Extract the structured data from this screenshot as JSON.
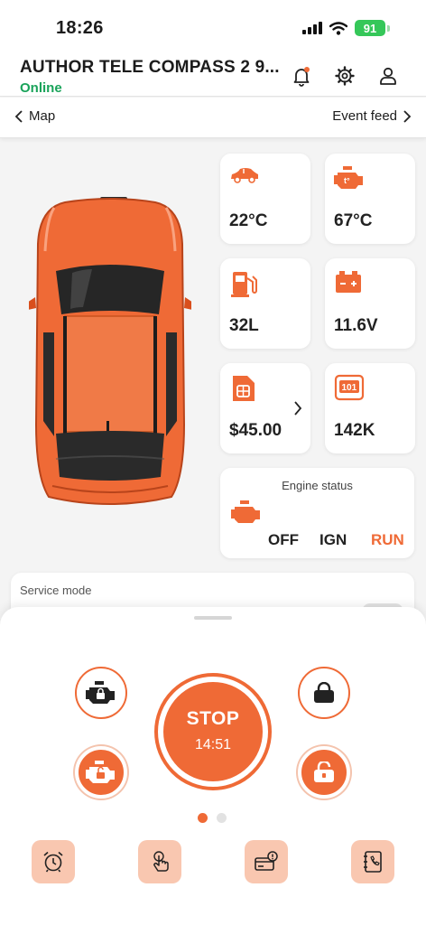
{
  "status_bar": {
    "time": "18:26",
    "battery": "91"
  },
  "header": {
    "car_name": "AUTHOR TELE COMPASS 2 9...",
    "status": "Online"
  },
  "nav": {
    "left_label": "Map",
    "right_label": "Event feed"
  },
  "tiles": {
    "cabin_temp": "22°C",
    "engine_temp": "67°C",
    "fuel": "32L",
    "battery_voltage": "11.6V",
    "balance": "$45.00",
    "mileage": "142K"
  },
  "engine_status": {
    "title": "Engine status",
    "off": "OFF",
    "ign": "IGN",
    "run": "RUN",
    "active": "RUN"
  },
  "service_mode": {
    "label": "Service mode",
    "enabled": false
  },
  "controls": {
    "stop_label": "STOP",
    "timer": "14:51"
  },
  "pager": {
    "pages": 2,
    "current": 1
  },
  "colors": {
    "accent": "#ef6a36",
    "online": "#1aa35a",
    "accent_light": "#f9c7b0"
  }
}
